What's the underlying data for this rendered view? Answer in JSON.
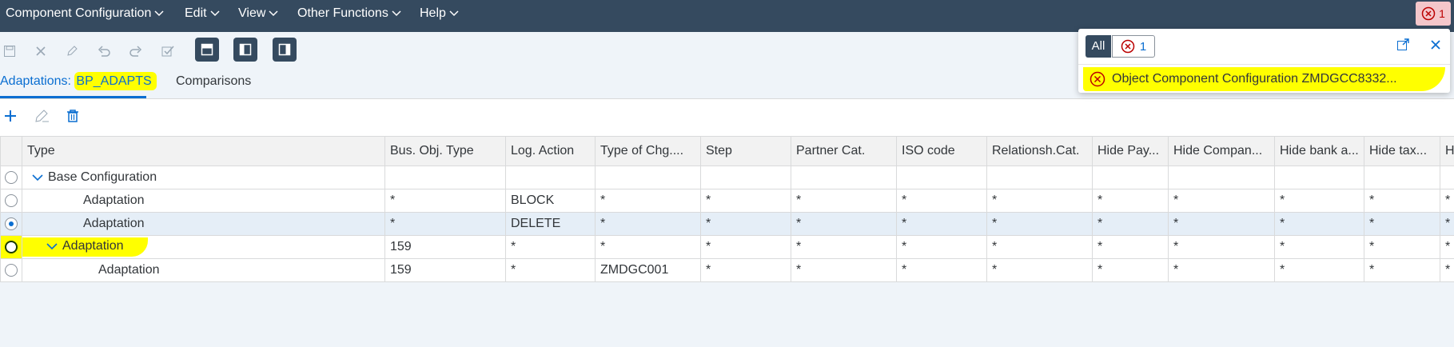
{
  "menubar": {
    "items": [
      "Component Configuration",
      "Edit",
      "View",
      "Other Functions",
      "Help"
    ],
    "error_count": "1"
  },
  "tabs": {
    "adaptations_label": "Adaptations: ",
    "adaptations_value": "BP_ADAPTS",
    "comparisons": "Comparisons"
  },
  "grid": {
    "columns": [
      "Type",
      "Bus. Obj. Type",
      "Log. Action",
      "Type of Chg....",
      "Step",
      "Partner Cat.",
      "ISO code",
      "Relationsh.Cat.",
      "Hide Pay...",
      "Hide Compan...",
      "Hide bank a...",
      "Hide tax...",
      "H"
    ],
    "rows": [
      {
        "type": "Base Configuration",
        "cells": [
          "",
          "",
          "",
          "",
          "",
          "",
          "",
          "",
          "",
          "",
          "",
          ""
        ]
      },
      {
        "type": "Adaptation",
        "cells": [
          "*",
          "BLOCK",
          "*",
          "*",
          "*",
          "*",
          "*",
          "*",
          "*",
          "*",
          "*",
          "*"
        ]
      },
      {
        "type": "Adaptation",
        "cells": [
          "*",
          "DELETE",
          "*",
          "*",
          "*",
          "*",
          "*",
          "*",
          "*",
          "*",
          "*",
          "*"
        ]
      },
      {
        "type": "Adaptation",
        "cells": [
          "159",
          "*",
          "*",
          "*",
          "*",
          "*",
          "*",
          "*",
          "*",
          "*",
          "*",
          "*"
        ]
      },
      {
        "type": "Adaptation",
        "cells": [
          "159",
          "*",
          "ZMDGC001",
          "*",
          "*",
          "*",
          "*",
          "*",
          "*",
          "*",
          "*",
          "*"
        ]
      }
    ]
  },
  "popover": {
    "all_label": "All",
    "error_count": "1",
    "message": "Object Component Configuration ZMDGCC8332..."
  },
  "colors": {
    "shell": "#354a5f",
    "accent": "#0a6ed1",
    "error": "#bb0000",
    "highlight": "#ffff00"
  }
}
